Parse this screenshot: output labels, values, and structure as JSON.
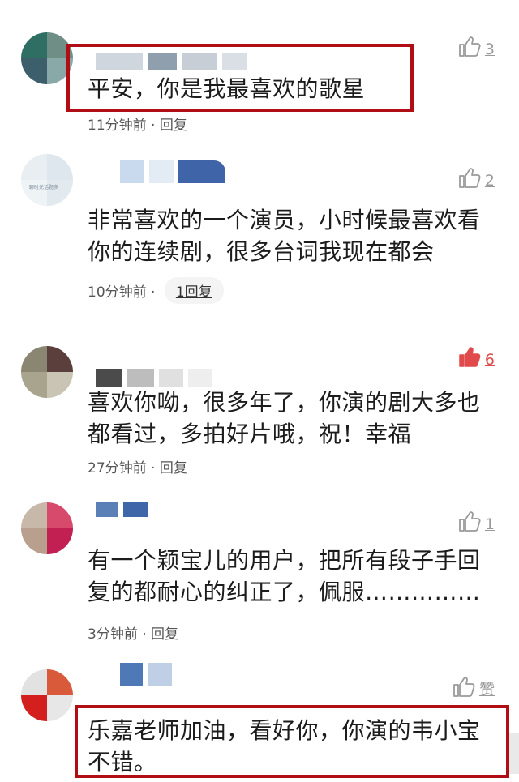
{
  "comments": [
    {
      "text": "平安，你是我最喜欢的歌星",
      "time": "11分钟前",
      "reply": "回复",
      "likes": "3",
      "liked": false,
      "highlighted": true,
      "avatar_colors": [
        "#2f6e62",
        "#6f8e86",
        "#3d5f6b",
        "#88a9a8"
      ]
    },
    {
      "text": "非常喜欢的一个演员，小时候最喜欢看你的连续剧，很多台词我现在都会",
      "time": "10分钟前",
      "reply": "1回复",
      "likes": "2",
      "liked": false,
      "highlighted": false,
      "avatar_colors": [
        "#e8eef2",
        "#dfe7ee",
        "#eef3f6",
        "#e2e9ef"
      ],
      "avatar_caption": "聊时光话题多"
    },
    {
      "text": "喜欢你呦，很多年了，你演的剧大多也都看过，多拍好片哦，祝！幸福",
      "time": "27分钟前",
      "reply": "回复",
      "likes": "6",
      "liked": true,
      "highlighted": false,
      "avatar_colors": [
        "#8a8672",
        "#5a3f3c",
        "#a9a48d",
        "#c9c4b4"
      ]
    },
    {
      "text": "有一个颖宝儿的用户，把所有段子手回复的都耐心的纠正了，佩服……………",
      "time": "3分钟前",
      "reply": "回复",
      "likes": "1",
      "liked": false,
      "highlighted": false,
      "avatar_colors": [
        "#c7b8aa",
        "#d84a6c",
        "#b99f8e",
        "#c21f52"
      ]
    },
    {
      "text": "乐嘉老师加油，看好你，你演的韦小宝不错。",
      "time": "",
      "reply": "",
      "likes": "赞",
      "liked": false,
      "highlighted": true,
      "avatar_colors": [
        "#e2e2e2",
        "#d85a3a",
        "#d41f1f",
        "#e7e7e7"
      ]
    }
  ],
  "meta_separator": " · "
}
